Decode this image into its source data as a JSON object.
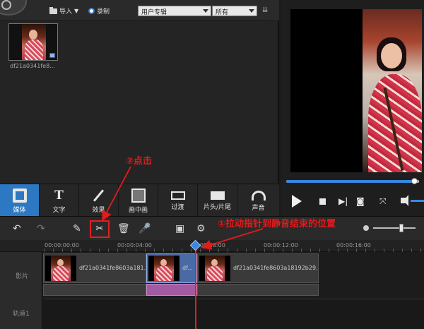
{
  "media_toolbar": {
    "import_label": "导入",
    "record_label": "录制",
    "category_select": "用户专辑",
    "filter_select": "所有"
  },
  "media_library": {
    "items": [
      {
        "filename": "df21a0341fe8..."
      }
    ]
  },
  "preview": {
    "progress": 0.97
  },
  "tabs": [
    {
      "label": "媒体",
      "icon": "media-icon",
      "active": true
    },
    {
      "label": "文字",
      "icon": "text-icon",
      "active": false
    },
    {
      "label": "效果",
      "icon": "magic-wand-icon",
      "active": false
    },
    {
      "label": "画中画",
      "icon": "pip-icon",
      "active": false
    },
    {
      "label": "过渡",
      "icon": "transition-icon",
      "active": false
    },
    {
      "label": "片头/片尾",
      "icon": "clapper-icon",
      "active": false
    },
    {
      "label": "声音",
      "icon": "headphones-icon",
      "active": false
    }
  ],
  "timeline": {
    "ruler_labels": [
      "00:00:00:00",
      "00:00:04:00",
      "00:00:08:00",
      "00:00:12:00",
      "00:00:16:00"
    ],
    "tracks": {
      "video": "影片",
      "track1": "轨道1"
    },
    "clips": [
      {
        "name": "df21a0341fe8603a181...",
        "selected": false
      },
      {
        "name": "df...",
        "selected": true
      },
      {
        "name": "df21a0341fe8603a18192b29...",
        "selected": false
      }
    ]
  },
  "annotations": {
    "click_step": "②点击",
    "drag_step": "①拉动指针到静音结束的位置"
  },
  "colors": {
    "accent": "#2d78c2",
    "annotation": "#e51a1a",
    "selected_audio": "#a25aa0"
  }
}
